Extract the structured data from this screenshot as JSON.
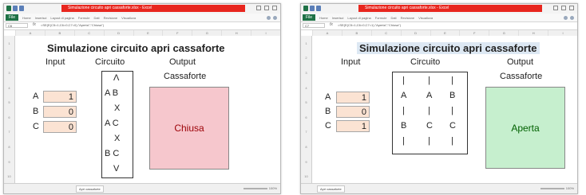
{
  "window": {
    "title": "Simulazione circuito apri cassaforte.xlsx - Excel",
    "file_tab": "File",
    "ribbon_tabs": [
      "Home",
      "Inserisci",
      "Layout di pagina",
      "Formule",
      "Dati",
      "Revisione",
      "Visualizza"
    ],
    "namebox_left": "C6",
    "namebox_right": "C7",
    "formula_left": "=SE(E(C5=1;C6=0;C7=0);\"Aperta\";\"Chiusa\")",
    "formula_right": "=SE(E(C5=1;C6=0;C7=1);\"Aperta\";\"Chiusa\")",
    "column_headers": [
      "A",
      "B",
      "C",
      "D",
      "E",
      "F",
      "G",
      "H",
      "I"
    ],
    "row_headers": [
      "1",
      "2",
      "3",
      "4",
      "5",
      "6",
      "7",
      "8",
      "9",
      "10"
    ],
    "sheet_tab": "Apri cassaforte",
    "zoom": "100%"
  },
  "left": {
    "title": "Simulazione circuito apri cassaforte",
    "header_input": "Input",
    "header_circuit": "Circuito",
    "header_output_1": "Output",
    "header_output_2": "Cassaforte",
    "inputs": [
      {
        "label": "A",
        "value": "1"
      },
      {
        "label": "B",
        "value": "0"
      },
      {
        "label": "C",
        "value": "0"
      }
    ],
    "circuit_lines": [
      "Λ",
      "A   B",
      "X",
      "A   C",
      "X",
      "B   C",
      "V"
    ],
    "output": "Chiusa",
    "output_color": "#f6c7cd"
  },
  "right": {
    "title": "Simulazione circuito apri cassaforte",
    "header_input": "Input",
    "header_circuit": "Circuito",
    "header_output_1": "Output",
    "header_output_2": "Cassaforte",
    "inputs": [
      {
        "label": "A",
        "value": "1"
      },
      {
        "label": "B",
        "value": "0"
      },
      {
        "label": "C",
        "value": "1"
      }
    ],
    "circuit_rows": [
      [
        "|",
        "|",
        "|"
      ],
      [
        "A",
        "A",
        "B"
      ],
      [
        "|",
        "|",
        "|"
      ],
      [
        "B",
        "C",
        "C"
      ],
      [
        "|",
        "|",
        "|"
      ]
    ],
    "output": "Aperta",
    "output_color": "#c6efce"
  }
}
